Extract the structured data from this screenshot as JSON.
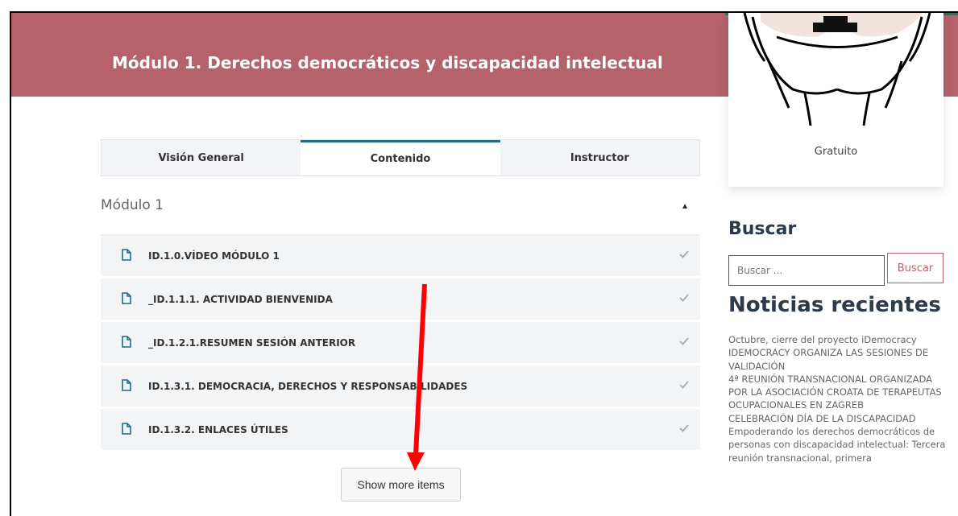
{
  "hero": {
    "title": "Módulo 1. Derechos democráticos y discapacidad intelectual"
  },
  "tabs": [
    {
      "label": "Visión General",
      "active": false
    },
    {
      "label": "Contenido",
      "active": true
    },
    {
      "label": "Instructor",
      "active": false
    }
  ],
  "section": {
    "title": "Módulo 1",
    "toggle_icon": "caret-up-icon"
  },
  "lessons": [
    {
      "label": "ID.1.0.VÍDEO MÓDULO 1",
      "icon": "document-icon",
      "status_icon": "check-icon"
    },
    {
      "label": "_ID.1.1.1. ACTIVIDAD BIENVENIDA",
      "icon": "document-icon",
      "status_icon": "check-icon"
    },
    {
      "label": "_ID.1.2.1.RESUMEN SESIÓN ANTERIOR",
      "icon": "document-icon",
      "status_icon": "check-icon"
    },
    {
      "label": "ID.1.3.1. DEMOCRACIA, DERECHOS Y RESPONSABILIDADES",
      "icon": "document-icon",
      "status_icon": "check-icon"
    },
    {
      "label": "ID.1.3.2. ENLACES ÚTILES",
      "icon": "document-icon",
      "status_icon": "check-icon"
    }
  ],
  "show_more": {
    "label": "Show more items"
  },
  "annotation": {
    "color": "#ff0000",
    "icon": "red-arrow-annotation"
  },
  "course_card": {
    "price": "Gratuito",
    "image": "hands-holding-ballot-illustration"
  },
  "search": {
    "heading": "Buscar",
    "placeholder": "Buscar ...",
    "button_label": "Buscar"
  },
  "news": {
    "heading": "Noticias recientes",
    "items": [
      "Octubre, cierre del proyecto iDemocracy",
      "IDEMOCRACY ORGANIZA LAS SESIONES DE VALIDACIÓN",
      "4ª REUNIÓN TRANSNACIONAL ORGANIZADA POR LA ASOCIACIÓN CROATA DE TERAPEUTAS OCUPACIONALES EN ZAGREB",
      "CELEBRACIÓN DÍA DE LA DISCAPACIDAD",
      "Empoderando los derechos democráticos de personas con discapacidad intelectual: Tercera reunión transnacional, primera"
    ]
  },
  "colors": {
    "brand": "#b5626a",
    "tab_accent": "#1b6c85",
    "heading": "#2d3a4a"
  }
}
